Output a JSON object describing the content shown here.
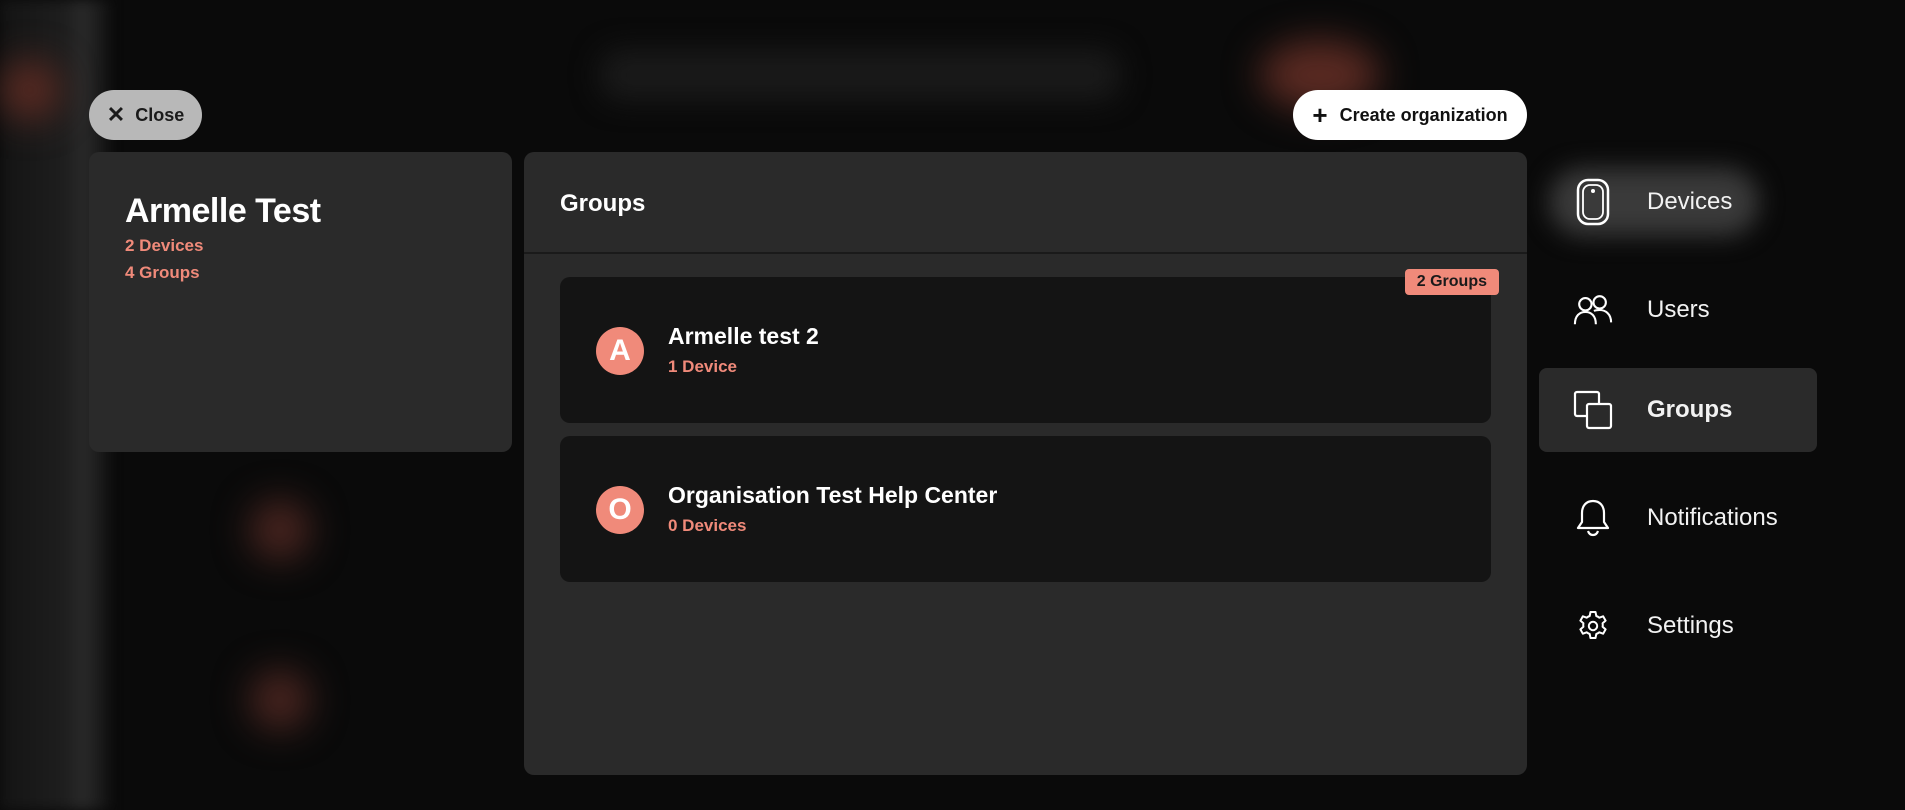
{
  "close_label": "Close",
  "create_label": "Create organization",
  "organization": {
    "name": "Armelle Test",
    "devices": "2 Devices",
    "groups": "4 Groups"
  },
  "groups_panel": {
    "title": "Groups",
    "items": [
      {
        "initial": "A",
        "name": "Armelle test 2",
        "sub": "1 Device",
        "badge": "2 Groups"
      },
      {
        "initial": "O",
        "name": "Organisation Test Help Center",
        "sub": "0 Devices"
      }
    ]
  },
  "nav": {
    "items": [
      {
        "label": "Devices",
        "icon": "device-icon"
      },
      {
        "label": "Users",
        "icon": "users-icon"
      },
      {
        "label": "Groups",
        "icon": "groups-icon",
        "active": true
      },
      {
        "label": "Notifications",
        "icon": "bell-icon"
      },
      {
        "label": "Settings",
        "icon": "gear-icon"
      }
    ]
  },
  "colors": {
    "accent": "#f08a7a",
    "panel": "#2a2a2a",
    "card": "#141414"
  }
}
